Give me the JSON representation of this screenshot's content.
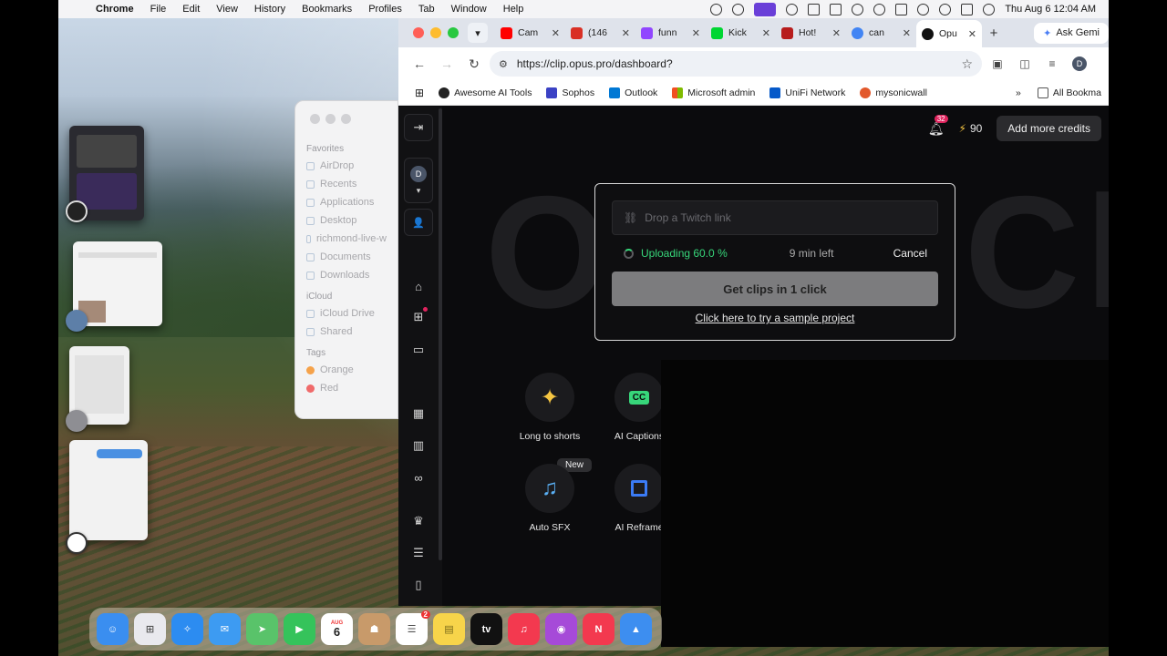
{
  "menubar": {
    "app_name": "Chrome",
    "items": [
      "File",
      "Edit",
      "View",
      "History",
      "Bookmarks",
      "Profiles",
      "Tab",
      "Window",
      "Help"
    ],
    "datetime": "Thu Aug 6  12:04 AM"
  },
  "finder": {
    "sections": {
      "favorites": "Favorites",
      "icloud": "iCloud",
      "tags": "Tags"
    },
    "favorites": [
      "AirDrop",
      "Recents",
      "Applications",
      "Desktop",
      "richmond-live-w",
      "Documents",
      "Downloads"
    ],
    "icloud": [
      "iCloud Drive",
      "Shared"
    ],
    "tags": [
      {
        "label": "Orange",
        "color": "#f5a24a"
      },
      {
        "label": "Red",
        "color": "#f06a6a"
      }
    ]
  },
  "browser": {
    "tabs": [
      {
        "label": "Cam",
        "favicon_color": "#ff0000",
        "icon": "youtube-icon"
      },
      {
        "label": "(146",
        "favicon_color": "#d93025",
        "icon": "mail-icon"
      },
      {
        "label": "funn",
        "favicon_color": "#9146ff",
        "icon": "twitch-icon"
      },
      {
        "label": "Kick",
        "favicon_color": "#00d632",
        "icon": "kick-icon"
      },
      {
        "label": "Hot!",
        "favicon_color": "#b71c1c",
        "icon": "news-icon"
      },
      {
        "label": "can",
        "favicon_color": "#4285f4",
        "icon": "google-icon"
      },
      {
        "label": "Opu",
        "favicon_color": "#111111",
        "icon": "opus-icon",
        "active": true
      }
    ],
    "ask_gemini": "Ask Gemi",
    "url": "https://clip.opus.pro/dashboard?",
    "profile_initial": "D",
    "bookmarks": [
      {
        "label": "Awesome AI Tools",
        "color": "#222222"
      },
      {
        "label": "Sophos",
        "color": "#3b42c4"
      },
      {
        "label": "Outlook",
        "color": "#0078d4"
      },
      {
        "label": "Microsoft admin",
        "color": "#f25022"
      },
      {
        "label": "UniFi Network",
        "color": "#0559c9"
      },
      {
        "label": "mysonicwall",
        "color": "#e2582b"
      }
    ],
    "all_bookmarks": "All Bookma"
  },
  "opus": {
    "background_logo": "Opus Clip",
    "profile_initial": "D",
    "notifications_count": "32",
    "credits": "90",
    "add_credits_label": "Add more credits",
    "link_placeholder": "Drop a Twitch link",
    "uploading_text": "Uploading 60.0 %",
    "upload_progress": 60.0,
    "time_left": "9 min left",
    "cancel_label": "Cancel",
    "get_clips_label": "Get clips in 1 click",
    "sample_link": "Click here to try a sample project",
    "new_label": "New",
    "tools": [
      {
        "label": "Long to shorts",
        "icon": "sparkle-icon",
        "color": "#f5c542"
      },
      {
        "label": "AI Captions",
        "icon": "cc-icon",
        "color": "#37d67a"
      },
      {
        "label": "Auto SFX",
        "icon": "music-note-icon",
        "color": "#5ab0f5"
      },
      {
        "label": "AI Reframe",
        "icon": "reframe-icon",
        "color": "#3b7bf5"
      }
    ]
  },
  "dock": {
    "apps": [
      {
        "name": "Finder",
        "color": "#3a8ef0"
      },
      {
        "name": "Launchpad",
        "color": "#e9e9ee"
      },
      {
        "name": "Safari",
        "color": "#2c8cf1"
      },
      {
        "name": "Mail",
        "color": "#3d9bf2"
      },
      {
        "name": "Maps",
        "color": "#59c36a"
      },
      {
        "name": "FaceTime",
        "color": "#35c35b"
      },
      {
        "name": "Calendar",
        "color": "#ffffff",
        "text": "6",
        "month": "AUG"
      },
      {
        "name": "Contacts",
        "color": "#c89a6a"
      },
      {
        "name": "Reminders",
        "color": "#ffffff",
        "badge": "2"
      },
      {
        "name": "Notes",
        "color": "#f7d44a"
      },
      {
        "name": "TV",
        "color": "#111111",
        "text": "tv"
      },
      {
        "name": "Music",
        "color": "#f3394f"
      },
      {
        "name": "Podcasts",
        "color": "#a64ad8"
      },
      {
        "name": "News",
        "color": "#f3394f"
      },
      {
        "name": "Keynote",
        "color": "#3d8ef0"
      }
    ]
  }
}
